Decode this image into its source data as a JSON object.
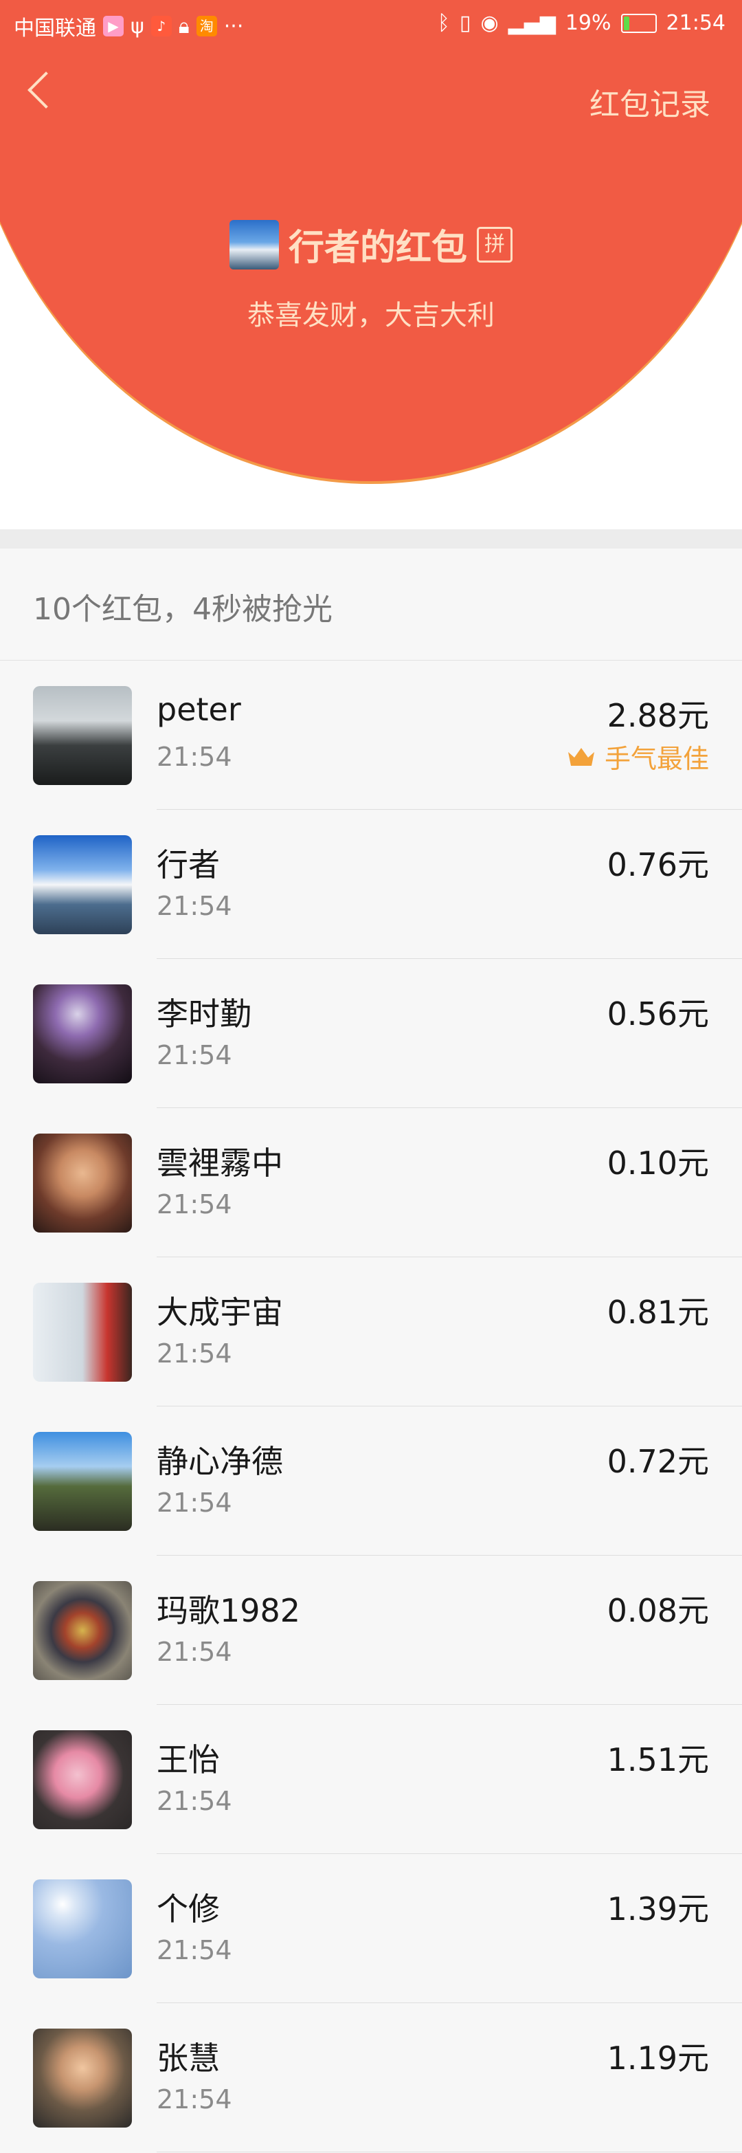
{
  "status_bar": {
    "carrier": "中国联通",
    "battery": "19%",
    "battery_level": 0.19,
    "time": "21:54"
  },
  "header": {
    "back_icon": "chevron-left-icon",
    "records_label": "红包记录",
    "title": "行者的红包",
    "pin_badge": "拼",
    "subtitle": "恭喜发财，大吉大利"
  },
  "summary": "10个红包，4秒被抢光",
  "best_label": "手气最佳",
  "colors": {
    "brand_red": "#f15b44",
    "best_gold": "#f3a23a"
  },
  "recipients": [
    {
      "name": "peter",
      "time": "21:54",
      "amount": "2.88元",
      "best": true
    },
    {
      "name": "行者",
      "time": "21:54",
      "amount": "0.76元"
    },
    {
      "name": "李时勤",
      "time": "21:54",
      "amount": "0.56元"
    },
    {
      "name": "雲裡霧中",
      "time": "21:54",
      "amount": "0.10元"
    },
    {
      "name": "大成宇宙",
      "time": "21:54",
      "amount": "0.81元"
    },
    {
      "name": "静心净德",
      "time": "21:54",
      "amount": "0.72元"
    },
    {
      "name": "玛歌1982",
      "time": "21:54",
      "amount": "0.08元"
    },
    {
      "name": "王怡",
      "time": "21:54",
      "amount": "1.51元"
    },
    {
      "name": "个修",
      "time": "21:54",
      "amount": "1.39元"
    },
    {
      "name": "张慧",
      "time": "21:54",
      "amount": "1.19元"
    }
  ]
}
